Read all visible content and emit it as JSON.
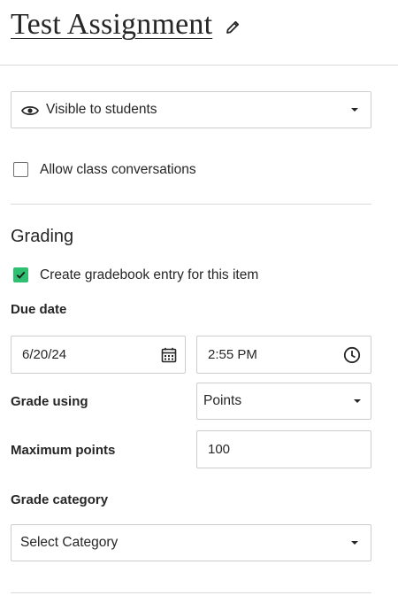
{
  "header": {
    "title": "Test Assignment"
  },
  "visibility": {
    "selected": "Visible to students"
  },
  "conversations": {
    "label": "Allow class conversations",
    "checked": false
  },
  "grading": {
    "heading": "Grading",
    "gradebook_entry": {
      "label": "Create gradebook entry for this item",
      "checked": true
    },
    "due_date": {
      "label": "Due date",
      "date_value": "6/20/24",
      "time_value": "2:55 PM"
    },
    "grade_using": {
      "label": "Grade using",
      "selected": "Points"
    },
    "maximum_points": {
      "label": "Maximum points",
      "value": "100"
    },
    "grade_category": {
      "label": "Grade category",
      "selected": "Select Category"
    }
  },
  "colors": {
    "accent_check": "#2fbf71",
    "border": "#cdcdcd",
    "divider": "#d9d9d9",
    "text": "#262626"
  },
  "icons": {
    "edit": "pencil-icon",
    "visibility": "eye-icon",
    "date": "calendar-icon",
    "time": "clock-icon",
    "dropdown": "chevron-down-icon",
    "checked": "checkmark-icon"
  }
}
